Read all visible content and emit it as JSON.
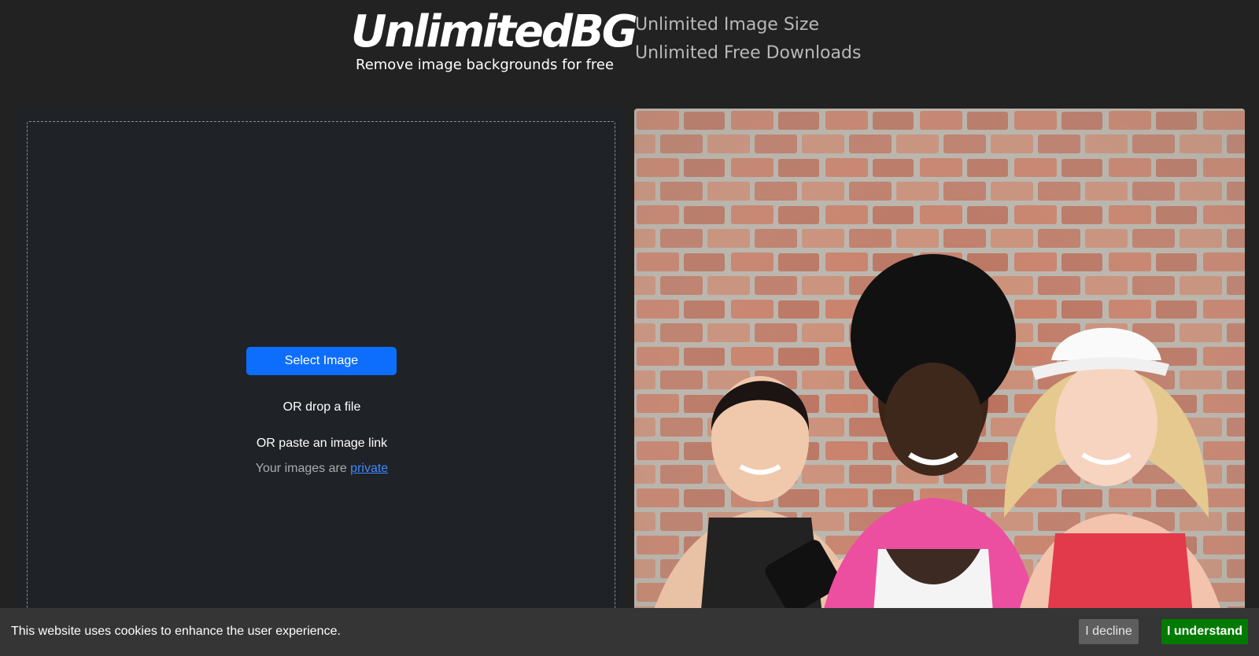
{
  "header": {
    "logo": "UnlimitedBG",
    "tagline": "Remove image backgrounds for free",
    "features": [
      "Unlimited Image Size",
      "Unlimited Free Downloads"
    ]
  },
  "upload": {
    "select_button": "Select Image",
    "drop_text": "OR drop a file",
    "paste_text": "OR paste an image link",
    "private_prefix": "Your images are",
    "private_link": "private"
  },
  "cookie": {
    "message": "This website uses cookies to enhance the user experience.",
    "decline_label": "I decline",
    "accept_label": "I understand"
  },
  "colors": {
    "background": "#222222",
    "panel": "#1f2227",
    "primary_button": "#0d6efd",
    "accept_button": "#007a00",
    "decline_button": "#5e5e5e"
  }
}
